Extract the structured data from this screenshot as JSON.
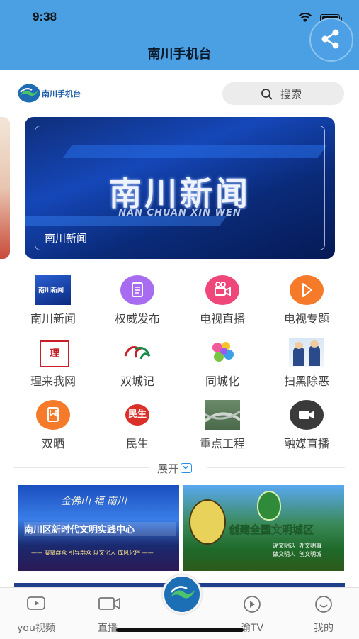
{
  "status_bar": {
    "time": "9:38"
  },
  "header": {
    "title": "南川手机台"
  },
  "topbar": {
    "logo_text": "南川手机台",
    "search_placeholder": "搜索"
  },
  "banner": {
    "title": "南川新闻",
    "pinyin": "NAN CHUAN XIN WEN",
    "caption": "南川新闻"
  },
  "grid": [
    {
      "label": "南川新闻",
      "icon": "tv-news-thumb-icon"
    },
    {
      "label": "权威发布",
      "icon": "document-icon",
      "color": "#a86cf0"
    },
    {
      "label": "电视直播",
      "icon": "camera-icon",
      "color": "#f0477a"
    },
    {
      "label": "电视专题",
      "icon": "play-icon",
      "color": "#f57a2a"
    },
    {
      "label": "理来我网",
      "icon": "seal-logo-icon"
    },
    {
      "label": "双城记",
      "icon": "swirl-logo-icon"
    },
    {
      "label": "同城化",
      "icon": "map-logo-icon"
    },
    {
      "label": "扫黑除恶",
      "icon": "police-icon"
    },
    {
      "label": "双晒",
      "icon": "bookmark-icon",
      "color": "#f57a2a"
    },
    {
      "label": "民生",
      "icon": "minsheng-logo-icon"
    },
    {
      "label": "重点工程",
      "icon": "road-photo-icon"
    },
    {
      "label": "融媒直播",
      "icon": "video-camera-icon",
      "color": "#3a3a3a"
    }
  ],
  "expand_label": "展开",
  "cards": [
    {
      "top": "金佛山 福 南川",
      "main": "南川区新时代文明实践中心",
      "bottom": "—— 凝聚群众 引导群众 以文化人 成风化俗 ——"
    },
    {
      "main": "创建全国文明城区",
      "sub": "说文明话  办文明事\n做文明人  创文明城"
    }
  ],
  "tabs": [
    {
      "label": "you视频"
    },
    {
      "label": "直播"
    },
    {
      "label": "渝TV"
    },
    {
      "label": "我的"
    }
  ]
}
